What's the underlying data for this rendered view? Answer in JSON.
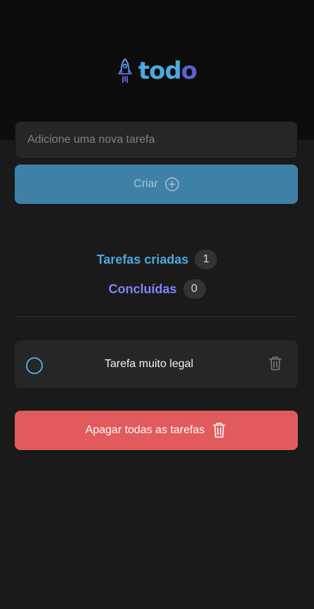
{
  "header": {
    "logo_text": "todo",
    "logo_icon": "rocket-icon",
    "colors": {
      "primary": "#4ea8de",
      "secondary": "#5e60ce"
    }
  },
  "new_task": {
    "placeholder": "Adicione uma nova tarefa",
    "create_label": "Criar",
    "create_icon": "plus-circle-icon"
  },
  "stats": {
    "created_label": "Tarefas criadas",
    "created_count": "1",
    "done_label": "Concluídas",
    "done_count": "0"
  },
  "tasks": [
    {
      "text": "Tarefa muito legal",
      "completed": false
    }
  ],
  "delete_all": {
    "label": "Apagar todas as tarefas",
    "icon": "trash-icon",
    "color": "#e15a5c"
  }
}
